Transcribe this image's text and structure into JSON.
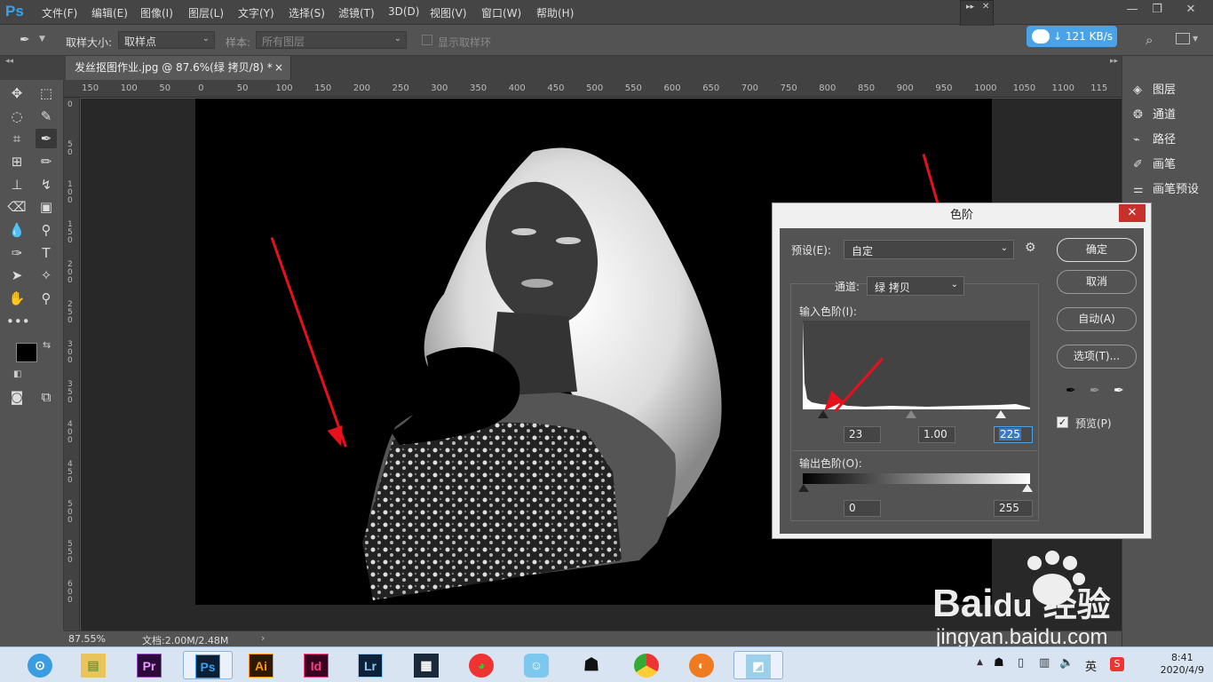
{
  "app": {
    "logo": "Ps"
  },
  "menu": [
    "文件(F)",
    "编辑(E)",
    "图像(I)",
    "图层(L)",
    "文字(Y)",
    "选择(S)",
    "滤镜(T)",
    "3D(D)",
    "视图(V)",
    "窗口(W)",
    "帮助(H)"
  ],
  "options": {
    "sample_size_label": "取样大小:",
    "sample_size_value": "取样点",
    "sample_label": "样本:",
    "sample_value": "所有图层",
    "show_ring_label": "显示取样环"
  },
  "speed_badge": "121 KB/s",
  "document_tab": {
    "title": "发丝抠图作业.jpg @ 87.6%(绿 拷贝/8) *",
    "close": "×"
  },
  "ruler_top": [
    "150",
    "100",
    "50",
    "0",
    "50",
    "100",
    "150",
    "200",
    "250",
    "300",
    "350",
    "400",
    "450",
    "500",
    "550",
    "600",
    "650",
    "700",
    "750",
    "800",
    "850",
    "900",
    "950",
    "1000",
    "1050",
    "1100",
    "115"
  ],
  "ruler_left": [
    "0",
    "50",
    "100",
    "150",
    "200",
    "250",
    "300",
    "350",
    "400",
    "450",
    "500",
    "550",
    "600"
  ],
  "status": {
    "zoom": "87.55%",
    "doc": "文档:2.00M/2.48M"
  },
  "right_panel": [
    {
      "icon": "layers-icon",
      "label": "图层"
    },
    {
      "icon": "channels-icon",
      "label": "通道"
    },
    {
      "icon": "paths-icon",
      "label": "路径"
    },
    {
      "icon": "brush-icon",
      "label": "画笔"
    },
    {
      "icon": "brush-presets-icon",
      "label": "画笔预设"
    }
  ],
  "levels_dialog": {
    "title": "色阶",
    "preset_label": "预设(E):",
    "preset_value": "自定",
    "channel_label": "通道:",
    "channel_value": "绿 拷贝",
    "input_levels_label": "输入色阶(I):",
    "input_black": "23",
    "input_gamma": "1.00",
    "input_white": "225",
    "output_levels_label": "输出色阶(O):",
    "output_black": "0",
    "output_white": "255",
    "buttons": {
      "ok": "确定",
      "cancel": "取消",
      "auto": "自动(A)",
      "options": "选项(T)..."
    },
    "preview_label": "预览(P)",
    "preview_checked": true
  },
  "taskbar": {
    "apps": [
      "Pr",
      "Ps",
      "Ai",
      "Id",
      "Lr"
    ],
    "tray_ime": "英",
    "time": "8:41",
    "date": "2020/4/9"
  },
  "watermark": {
    "brand": "Bai",
    "brand2": "du",
    "cn": "经验",
    "url": "jingyan.baidu.com"
  },
  "colors": {
    "ps_blue": "#36a3f0",
    "arrow_red": "#e8101a",
    "close_red": "#c8302c"
  }
}
